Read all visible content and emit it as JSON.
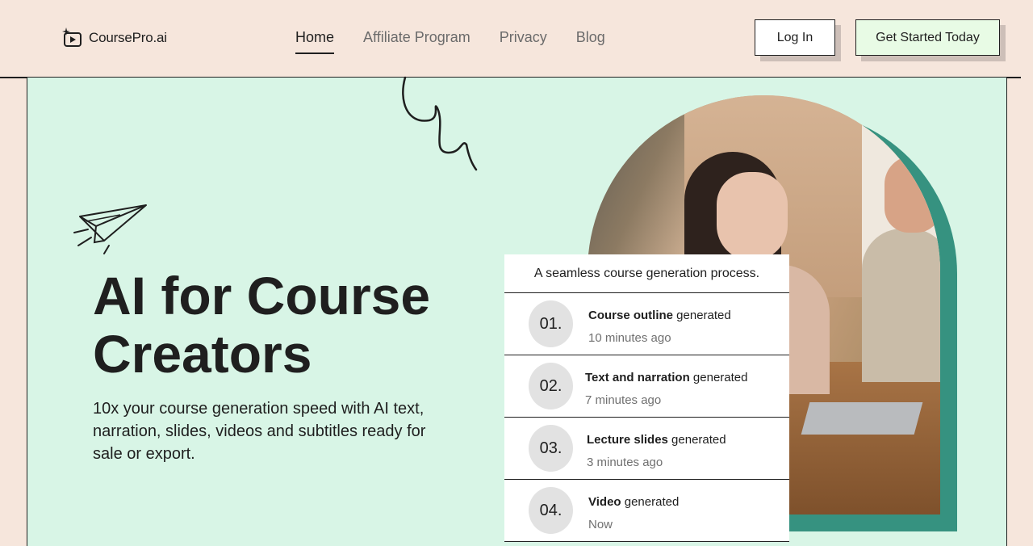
{
  "brand": {
    "name": "CoursePro.ai"
  },
  "nav": {
    "items": [
      {
        "label": "Home",
        "active": true
      },
      {
        "label": "Affiliate Program",
        "active": false
      },
      {
        "label": "Privacy",
        "active": false
      },
      {
        "label": "Blog",
        "active": false
      }
    ]
  },
  "header": {
    "login_label": "Log In",
    "cta_label": "Get Started Today"
  },
  "hero": {
    "title": "AI for Course Creators",
    "subtitle": "10x your course generation speed with AI text, narration, slides, videos and subtitles ready for sale or export."
  },
  "process_card": {
    "heading": "A seamless course generation process.",
    "steps": [
      {
        "number": "01.",
        "title_bold": "Course outline",
        "title_rest": " generated",
        "time": "10 minutes ago"
      },
      {
        "number": "02.",
        "title_bold": "Text and narration",
        "title_rest": " generated",
        "time": "7 minutes ago"
      },
      {
        "number": "03.",
        "title_bold": "Lecture slides",
        "title_rest": " generated",
        "time": "3 minutes ago"
      },
      {
        "number": "04.",
        "title_bold": "Video",
        "title_rest": " generated",
        "time": "Now"
      }
    ]
  },
  "colors": {
    "page_bg": "#f6e6dc",
    "hero_bg": "#d8f5e6",
    "accent_teal": "#369280",
    "cta_bg": "#e8fbe5"
  },
  "icons": [
    "logo-play-sparkle-icon",
    "paper-plane-icon",
    "squiggle-decoration"
  ]
}
